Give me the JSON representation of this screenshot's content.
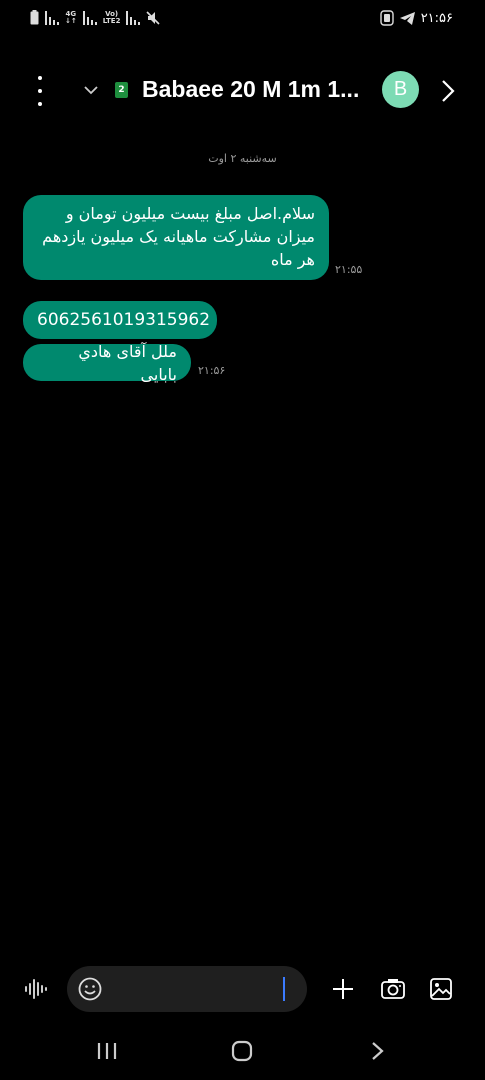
{
  "status_bar": {
    "time": "۲۱:۵۶",
    "net_4g_top": "4G",
    "net_4g_bottom": "↓↑",
    "volte_top": "Vo)",
    "volte_bottom": "LTE2"
  },
  "header": {
    "sim_number": "2",
    "contact_name": "Babaee 20 M 1m 1...",
    "avatar_letter": "B"
  },
  "conversation": {
    "date_label": "سه‌شنبه ۲ اوت",
    "messages": [
      {
        "text": "سلام.اصل مبلغ بیست میلیون تومان و میزان مشارکت ماهیانه یک میلیون یازدهم هر ماه",
        "time": "۲۱:۵۵"
      },
      {
        "text": "6062561019315962",
        "time": ""
      },
      {
        "text": "ملل آقای هادي بابايی",
        "time": "۲۱:۵۶"
      }
    ]
  },
  "composer": {
    "placeholder": ""
  },
  "colors": {
    "bubble": "#00896e",
    "avatar": "#7ddbb4",
    "background": "#000000",
    "cursor": "#3b7bff"
  },
  "icons": [
    "battery-icon",
    "signal-icon",
    "mute-icon",
    "telegram-icon",
    "menu-icon",
    "chevron-down-icon",
    "next-arrow-icon",
    "voice-icon",
    "emoji-icon",
    "plus-icon",
    "camera-icon",
    "gallery-icon",
    "recents-icon",
    "home-icon",
    "back-icon"
  ]
}
